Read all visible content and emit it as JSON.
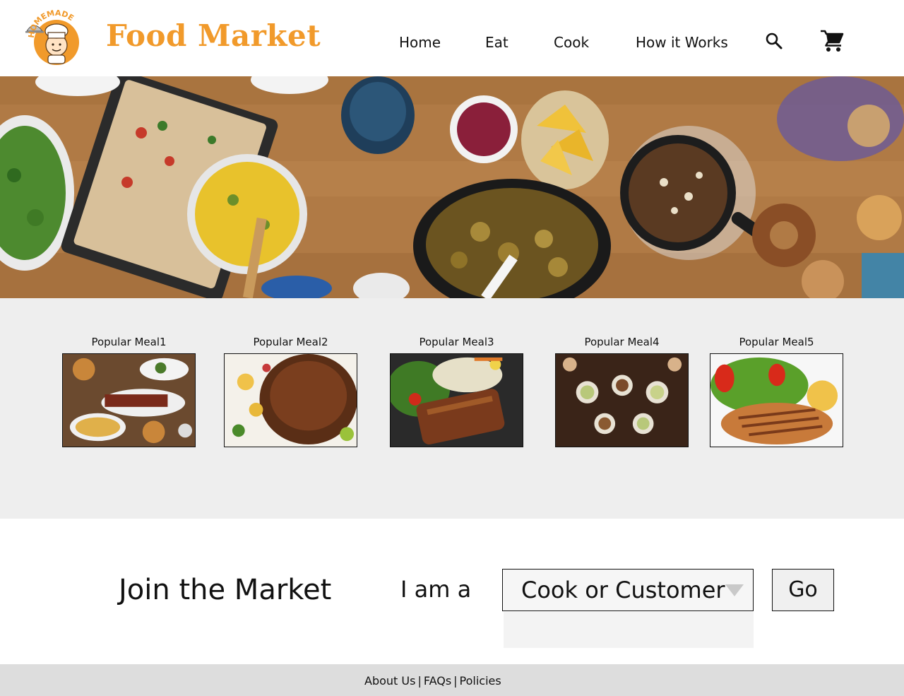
{
  "header": {
    "brand": "Food Market",
    "logo_text": "HOMEMADE",
    "nav": [
      "Home",
      "Eat",
      "Cook",
      "How it Works"
    ],
    "icons": {
      "search": "search-icon",
      "cart": "cart-icon"
    },
    "brand_color": "#f19a2b"
  },
  "hero": {
    "image": "food-table-spread-photo"
  },
  "popular": {
    "meals": [
      {
        "title": "Popular Meal1"
      },
      {
        "title": "Popular Meal2"
      },
      {
        "title": "Popular Meal3"
      },
      {
        "title": "Popular Meal4"
      },
      {
        "title": "Popular Meal5"
      }
    ]
  },
  "join": {
    "title": "Join the Market",
    "iam_label": "I am a",
    "select_value": "Cook or Customer",
    "go_label": "Go"
  },
  "footer": {
    "links": [
      "About Us",
      "FAQs",
      "Policies"
    ],
    "separator": "|"
  }
}
